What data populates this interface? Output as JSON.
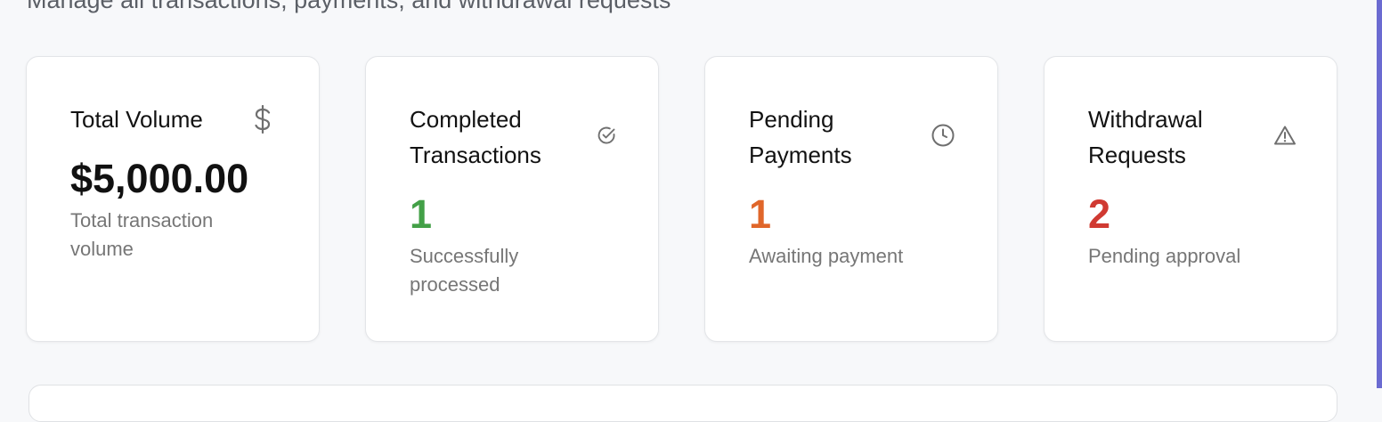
{
  "header": {
    "subtitle": "Manage all transactions, payments, and withdrawal requests"
  },
  "cards": [
    {
      "title": "Total Volume",
      "icon": "dollar-icon",
      "value": "$5,000.00",
      "description": "Total transaction volume",
      "value_color": "#111111"
    },
    {
      "title": "Completed Transactions",
      "icon": "check-circle-icon",
      "value": "1",
      "description": "Successfully processed",
      "value_color": "#43a047"
    },
    {
      "title": "Pending Payments",
      "icon": "clock-icon",
      "value": "1",
      "description": "Awaiting payment",
      "value_color": "#e0662a"
    },
    {
      "title": "Withdrawal Requests",
      "icon": "alert-triangle-icon",
      "value": "2",
      "description": "Pending approval",
      "value_color": "#d03a32"
    }
  ],
  "colors": {
    "page_background": "#f7f8fa",
    "card_background": "#ffffff",
    "muted_text": "#767676",
    "accent_edge": "#6b6bd1"
  }
}
